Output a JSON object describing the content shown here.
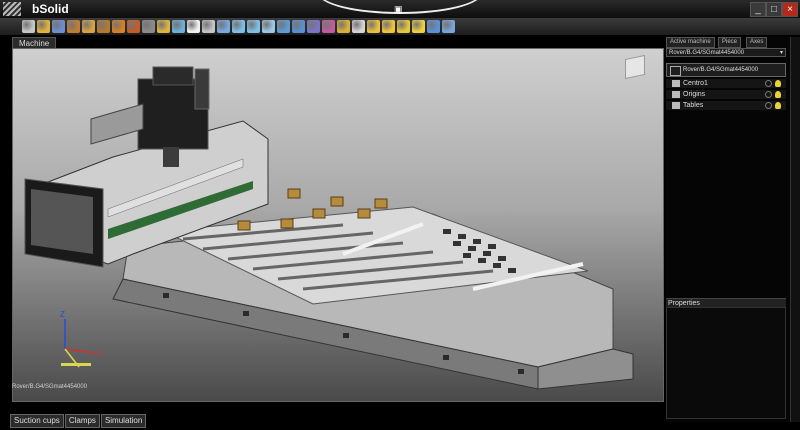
{
  "app": {
    "title": "bSolid"
  },
  "window_controls": [
    "_",
    "□",
    "×"
  ],
  "toolbar": {
    "buttons": [
      {
        "icon": "new-file-icon",
        "color": "#c8c8c8"
      },
      {
        "icon": "open-file-icon",
        "color": "#e3b23c"
      },
      {
        "icon": "save-icon",
        "color": "#6d8fd1"
      },
      {
        "icon": "cut-icon",
        "color": "#c07d35"
      },
      {
        "icon": "copy-icon",
        "color": "#d7a441"
      },
      {
        "icon": "paste-icon",
        "color": "#b67b2b"
      },
      {
        "icon": "undo-icon",
        "color": "#d97f25"
      },
      {
        "icon": "redo-icon",
        "color": "#c65b26"
      },
      {
        "icon": "grid-icon",
        "color": "#8a8a8a"
      },
      {
        "icon": "layers-icon",
        "color": "#e0b53d"
      },
      {
        "icon": "move-icon",
        "color": "#6db0d8"
      },
      {
        "icon": "rotate-icon",
        "color": "#f0f0f0"
      },
      {
        "icon": "pan-icon",
        "color": "#c5c5c5"
      },
      {
        "icon": "orbit-icon",
        "color": "#77a8e0"
      },
      {
        "icon": "zoom-in-icon",
        "color": "#7dc1e6"
      },
      {
        "icon": "zoom-out-icon",
        "color": "#7dc1e6"
      },
      {
        "icon": "zoom-window-icon",
        "color": "#9ec8e8"
      },
      {
        "icon": "zoom-fit-icon",
        "color": "#5e9cd3"
      },
      {
        "icon": "view-front-icon",
        "color": "#5b8fcf"
      },
      {
        "icon": "view-top-icon",
        "color": "#7a74c9"
      },
      {
        "icon": "view-side-icon",
        "color": "#c65aa0"
      },
      {
        "icon": "iso-view-icon",
        "color": "#d9b237"
      },
      {
        "icon": "wireframe-icon",
        "color": "#d6d6d6"
      },
      {
        "icon": "shaded-icon",
        "color": "#eac03c"
      },
      {
        "icon": "render-icon",
        "color": "#f1c43c"
      },
      {
        "icon": "section-icon",
        "color": "#e7c73b"
      },
      {
        "icon": "measure-icon",
        "color": "#f0ce3f"
      },
      {
        "icon": "simulate-icon",
        "color": "#5a90da"
      },
      {
        "icon": "globe-icon",
        "color": "#7aa6da"
      }
    ]
  },
  "viewport": {
    "tab_label": "Machine",
    "status_text": "Rover/B.G4/SGmat4454000"
  },
  "bottom_tabs": [
    "Suction cups",
    "Clamps",
    "Simulation"
  ],
  "right_panel": {
    "tabs": [
      "Active machine",
      "Piece",
      "Axes"
    ],
    "machine_select": "Rover/B.G4/SGmat4454000",
    "machine_field": "Rover/B.G4/SGmat4454000",
    "tree_items": [
      {
        "label": "Centro1",
        "icon": "machine-head-icon"
      },
      {
        "label": "Origins",
        "icon": "origin-icon"
      },
      {
        "label": "Tables",
        "icon": "table-icon"
      }
    ],
    "properties_label": "Properties"
  },
  "colors": {
    "machine_green": "#2f6b34",
    "machine_body": "#cfcfcf",
    "bed": "#e3e3e3",
    "pod_wood": "#b58b3d",
    "accent_blue": "#5e9cd3"
  }
}
